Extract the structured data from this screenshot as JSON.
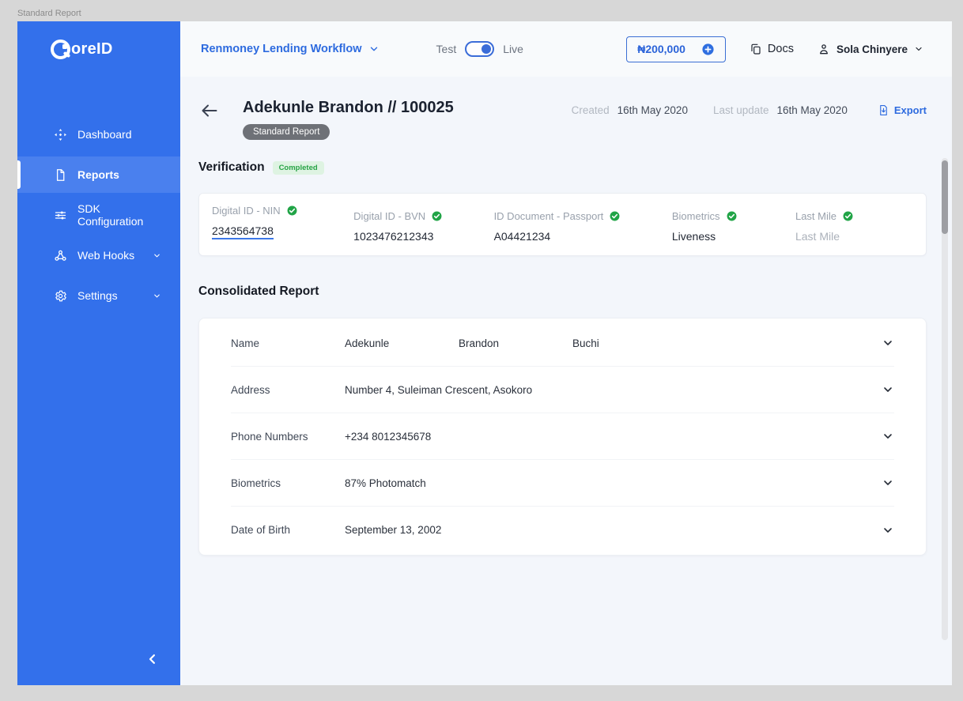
{
  "window": {
    "frame_label": "Standard Report"
  },
  "brand": {
    "wordmark": "QoreID",
    "logo_text": "oreID"
  },
  "sidebar": {
    "items": [
      {
        "label": "Dashboard",
        "icon": "dashboard-icon",
        "active": false,
        "expandable": false
      },
      {
        "label": "Reports",
        "icon": "reports-icon",
        "active": true,
        "expandable": false
      },
      {
        "label": "SDK Configuration",
        "icon": "sdk-configuration-icon",
        "active": false,
        "expandable": false
      },
      {
        "label": "Web Hooks",
        "icon": "webhooks-icon",
        "active": false,
        "expandable": true
      },
      {
        "label": "Settings",
        "icon": "settings-icon",
        "active": false,
        "expandable": true
      }
    ]
  },
  "topbar": {
    "workflow_label": "Renmoney Lending Workflow",
    "env": {
      "test_label": "Test",
      "live_label": "Live",
      "active": "Live"
    },
    "balance_label": "₦200,000",
    "docs_label": "Docs",
    "user_name": "Sola Chinyere"
  },
  "header": {
    "title": "Adekunle Brandon // 100025",
    "badge": "Standard Report",
    "created_label": "Created",
    "created_value": "16th May 2020",
    "updated_label": "Last update",
    "updated_value": "16th May 2020",
    "export_label": "Export"
  },
  "verification": {
    "heading": "Verification",
    "status_badge": "Completed",
    "items": [
      {
        "label": "Digital ID - NIN",
        "value": "2343564738",
        "link": true
      },
      {
        "label": "Digital ID - BVN",
        "value": "1023476212343"
      },
      {
        "label": "ID Document - Passport",
        "value": "A04421234"
      },
      {
        "label": "Biometrics",
        "value": "Liveness"
      },
      {
        "label": "Last Mile",
        "value": "Last Mile",
        "muted": true
      }
    ]
  },
  "report": {
    "heading": "Consolidated Report",
    "rows": [
      {
        "label": "Name",
        "values": [
          "Adekunle",
          "Brandon",
          "Buchi"
        ]
      },
      {
        "label": "Address",
        "values": [
          "Number 4, Suleiman Crescent, Asokoro"
        ]
      },
      {
        "label": "Phone Numbers",
        "values": [
          "+234 8012345678"
        ]
      },
      {
        "label": "Biometrics",
        "values": [
          "87% Photomatch"
        ]
      },
      {
        "label": "Date of Birth",
        "values": [
          "September 13, 2002"
        ]
      }
    ]
  },
  "colors": {
    "sidebar_blue": "#3370EB",
    "sidebar_active_blue": "#4A80EE",
    "accent_blue": "#2E6BDF",
    "success_green": "#21A447",
    "badge_gray": "#6E7177"
  }
}
